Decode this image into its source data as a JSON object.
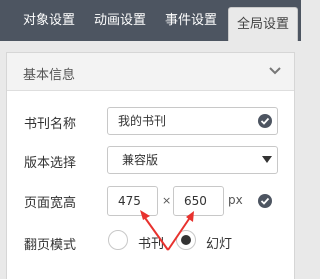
{
  "tabs": [
    {
      "label": "对象设置",
      "active": false
    },
    {
      "label": "动画设置",
      "active": false
    },
    {
      "label": "事件设置",
      "active": false
    },
    {
      "label": "全局设置",
      "active": true
    }
  ],
  "panel": {
    "title": "基本信息",
    "collapse_icon": "chevron-down-icon"
  },
  "form": {
    "title_label": "书刊名称",
    "title_value": "我的书刊",
    "version_label": "版本选择",
    "version_value": "兼容版",
    "size_label": "页面宽高",
    "width_value": "475",
    "times": "×",
    "height_value": "650",
    "unit": "px",
    "mode_label": "翻页模式",
    "mode_options": [
      {
        "label": "书刊",
        "selected": false
      },
      {
        "label": "幻灯",
        "selected": true
      }
    ]
  },
  "colors": {
    "tabbar": "#4d5561",
    "annotation_arrow": "#e8322e"
  }
}
